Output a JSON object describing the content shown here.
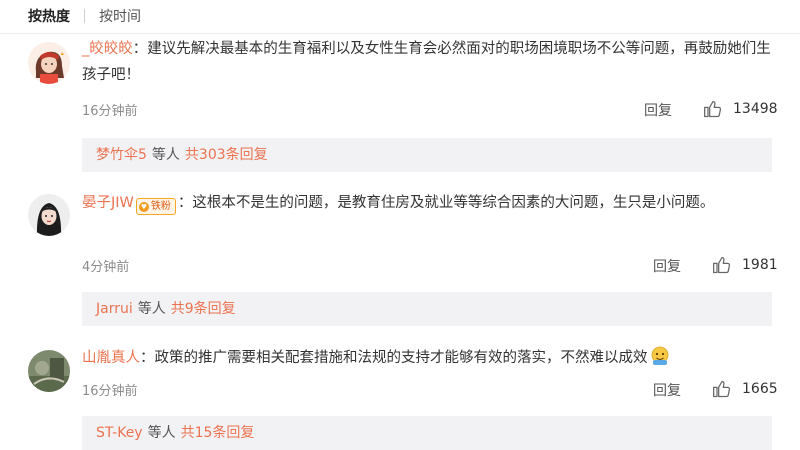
{
  "sort_tabs": {
    "hot": "按热度",
    "time": "按时间"
  },
  "comments": [
    {
      "user": "_皎皎皎",
      "text": "建议先解决最基本的生育福利以及女性生育会必然面对的职场困境职场不公等问题，再鼓励她们生孩子吧！",
      "time": "16分钟前",
      "reply_label": "回复",
      "likes": "13498",
      "sub": {
        "user": "梦竹伞5",
        "middle": "等人",
        "total": "共303条回复"
      }
    },
    {
      "user": "晏子JIW",
      "badge": "铁粉",
      "text": "这根本不是生的问题，是教育住房及就业等等综合因素的大问题，生只是小问题。",
      "time": "4分钟前",
      "reply_label": "回复",
      "likes": "1981",
      "sub": {
        "user": "Jarrui",
        "middle": "等人",
        "total": "共9条回复"
      }
    },
    {
      "user": "山胤真人",
      "text": "政策的推广需要相关配套措施和法规的支持才能够有效的落实，不然难以成效",
      "emoji": "emoji-face-icon",
      "time": "16分钟前",
      "reply_label": "回复",
      "likes": "1665",
      "sub": {
        "user": "ST-Key",
        "middle": "等人",
        "total": "共15条回复"
      }
    }
  ],
  "colors": {
    "username": "#eb7350",
    "sub_box_bg": "#f2f2f5",
    "time": "#8c8c8c"
  }
}
